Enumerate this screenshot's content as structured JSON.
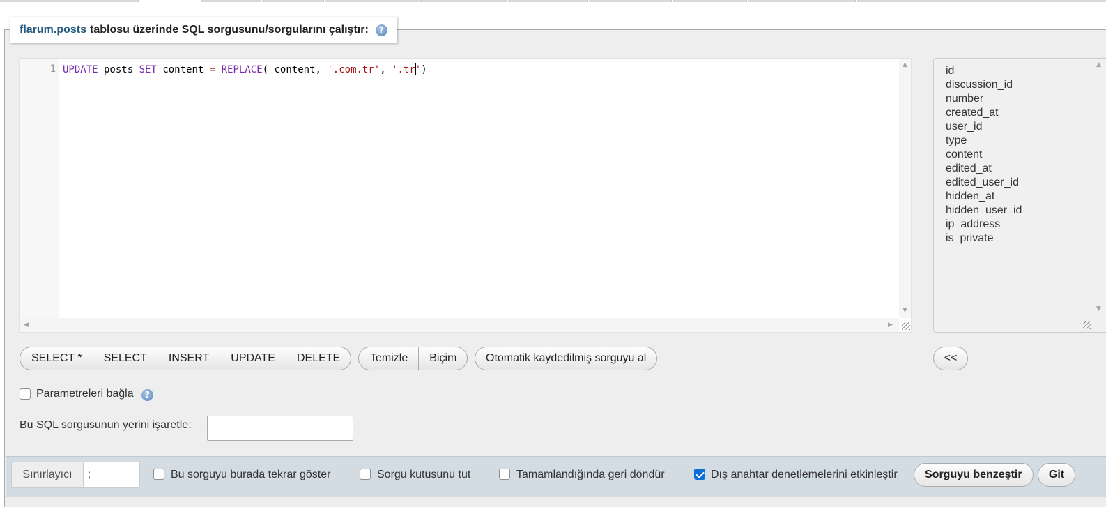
{
  "legend": {
    "table_name": "flarum.posts",
    "title_rest": "tablosu üzerinde SQL sorgusunu/sorgularını çalıştır:",
    "help_icon": "help-icon"
  },
  "editor": {
    "line_number": "1",
    "tokens": {
      "update": "UPDATE",
      "t1": " posts ",
      "set": "SET",
      "t2": " content ",
      "eq": "=",
      "t3": " ",
      "replace": "REPLACE",
      "t4": "( content, ",
      "s1": "'.com.tr'",
      "t5": ", ",
      "s2a": "'.tr",
      "s2b": "'",
      "t6": ")"
    }
  },
  "columns": [
    "id",
    "discussion_id",
    "number",
    "created_at",
    "user_id",
    "type",
    "content",
    "edited_at",
    "edited_user_id",
    "hidden_at",
    "hidden_user_id",
    "ip_address",
    "is_private"
  ],
  "query_buttons": [
    "SELECT *",
    "SELECT",
    "INSERT",
    "UPDATE",
    "DELETE"
  ],
  "format_buttons": [
    "Temizle",
    "Biçim"
  ],
  "autosave_button": "Otomatik kaydedilmiş sorguyu al",
  "insert_column_button": "<<",
  "bind_params": {
    "label": "Parametreleri bağla",
    "checked": false
  },
  "bookmark": {
    "label": "Bu SQL sorgusunun yerini işaretle:",
    "value": ""
  },
  "footer": {
    "delimiter_label": "Sınırlayıcı",
    "delimiter_value": ";",
    "show_query": {
      "label": "Bu sorguyu burada tekrar göster",
      "checked": false
    },
    "retain_box": {
      "label": "Sorgu kutusunu tut",
      "checked": false
    },
    "rollback": {
      "label": "Tamamlandığında geri döndür",
      "checked": false
    },
    "fk_checks": {
      "label": "Dış anahtar denetlemelerini etkinleştir",
      "checked": true
    },
    "simulate_button": "Sorguyu benzeştir",
    "go_button": "Git"
  },
  "colors": {
    "accent_blue": "#235a81",
    "checkbox_checked": "#0b6fd6",
    "footer_bg": "#d3dce3"
  }
}
